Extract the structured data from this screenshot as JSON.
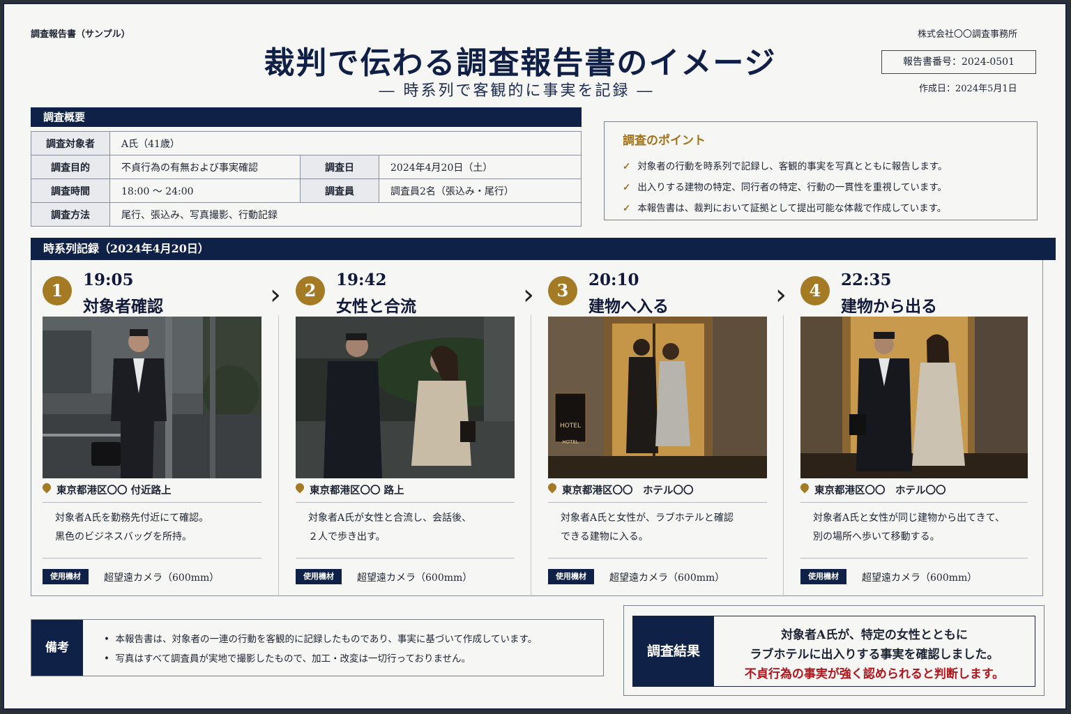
{
  "header": {
    "doc_label": "調査報告書（サンプル）",
    "title": "裁判で伝わる調査報告書のイメージ",
    "subtitle": "― 時系列で客観的に事実を記録 ―",
    "company": "株式会社〇〇調査事務所",
    "report_no": "報告書番号：2024-0501",
    "created": "作成日：2024年5月1日"
  },
  "overview": {
    "section_title": "調査概要",
    "target_label": "調査対象者",
    "target_value": "A氏（41歳）",
    "purpose_label": "調査目的",
    "purpose_value": "不貞行為の有無および事実確認",
    "date_label": "調査日",
    "date_value": "2024年4月20日（土）",
    "time_label": "調査時間",
    "time_value": "18:00 ～ 24:00",
    "staff_label": "調査員",
    "staff_value": "調査員2名（張込み・尾行）",
    "method_label": "調査方法",
    "method_value": "尾行、張込み、写真撮影、行動記録"
  },
  "points": {
    "title": "調査のポイント",
    "items": [
      "対象者の行動を時系列で記録し、客観的事実を写真とともに報告します。",
      "出入りする建物の特定、同行者の特定、行動の一貫性を重視しています。",
      "本報告書は、裁判において証拠として提出可能な体裁で作成しています。"
    ]
  },
  "timeline": {
    "section_title": "時系列記録（2024年4月20日）",
    "equipment_label": "使用機材",
    "entries": [
      {
        "num": "1",
        "time": "19:05",
        "event": "対象者確認",
        "location": "東京都港区〇〇 付近路上",
        "desc1": "対象者A氏を勤務先付近にて確認。",
        "desc2": "黒色のビジネスバッグを所持。",
        "equipment": "超望遠カメラ（600mm）"
      },
      {
        "num": "2",
        "time": "19:42",
        "event": "女性と合流",
        "location": "東京都港区〇〇 路上",
        "desc1": "対象者A氏が女性と合流し、会話後、",
        "desc2": "２人で歩き出す。",
        "equipment": "超望遠カメラ（600mm）"
      },
      {
        "num": "3",
        "time": "20:10",
        "event": "建物へ入る",
        "location": "東京都港区〇〇　ホテル〇〇",
        "desc1": "対象者A氏と女性が、ラブホテルと確認",
        "desc2": "できる建物に入る。",
        "equipment": "超望遠カメラ（600mm）"
      },
      {
        "num": "4",
        "time": "22:35",
        "event": "建物から出る",
        "location": "東京都港区〇〇　ホテル〇〇",
        "desc1": "対象者A氏と女性が同じ建物から出てきて、",
        "desc2": "別の場所へ歩いて移動する。",
        "equipment": "超望遠カメラ（600mm）"
      }
    ],
    "hotel_sign_1": "HOTEL",
    "hotel_sign_2": "HOTEL"
  },
  "notes": {
    "label": "備考",
    "items": [
      "本報告書は、対象者の一連の行動を客観的に記録したものであり、事実に基づいて作成しています。",
      "写真はすべて調査員が実地で撮影したもので、加工・改変は一切行っておりません。"
    ]
  },
  "result": {
    "label": "調査結果",
    "line1": "対象者A氏が、特定の女性とともに",
    "line2": "ラブホテルに出入りする事実を確認しました。",
    "line3": "不貞行為の事実が強く認められると判断します。"
  },
  "colors": {
    "navy": "#0f2147",
    "gold": "#a57a25",
    "emphasis": "#b3141b"
  }
}
